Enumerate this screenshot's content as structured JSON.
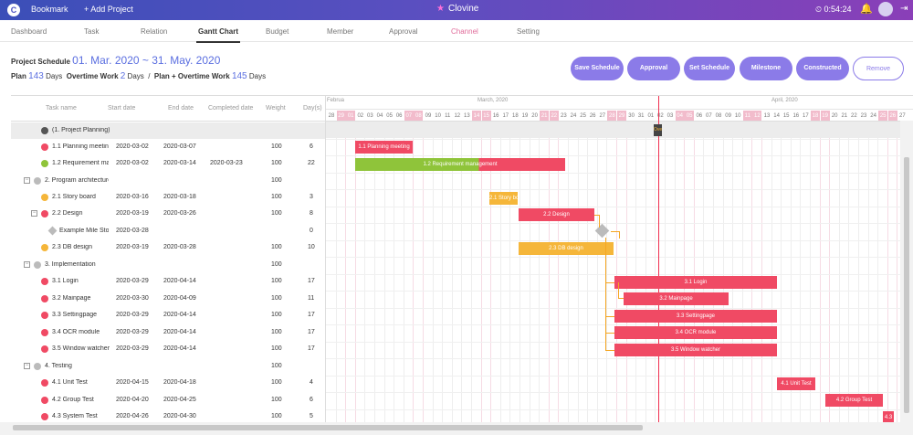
{
  "topbar": {
    "logo": "C",
    "bookmark": "Bookmark",
    "add_project": "+ Add Project",
    "brand": "Clovine",
    "clock": "⏲ 0:54:24",
    "bell_icon": "bell-icon",
    "logout_icon": "logout-icon"
  },
  "tabs": [
    "Dashboard",
    "Task",
    "Relation",
    "Gantt Chart",
    "Budget",
    "Member",
    "Approval",
    "Channel",
    "Setting"
  ],
  "active_tab": "Gantt Chart",
  "schedule": {
    "label": "Project Schedule",
    "range": "01. Mar. 2020 ~ 31. May. 2020",
    "plan_label": "Plan",
    "plan_days": "143",
    "days_unit": "Days",
    "overtime_label": "Overtime Work",
    "overtime_days": "2",
    "sep": "/",
    "total_label": "Plan + Overtime Work",
    "total_days": "145"
  },
  "buttons": {
    "save": "Save Schedule",
    "approval": "Approval",
    "set": "Set Schedule",
    "milestone": "Milestone",
    "constructed": "Constructed",
    "remove": "Remove"
  },
  "table_headers": [
    "Task name",
    "Start date",
    "End date",
    "Completed date",
    "Weight",
    "Day(s)"
  ],
  "rows": [
    {
      "name": "(1. Project Planning)",
      "start": "",
      "end": "",
      "completed": "",
      "weight": "",
      "days": ""
    },
    {
      "name": "1.1 Planning meeting",
      "start": "2020-03-02",
      "end": "2020-03-07",
      "completed": "",
      "weight": "100",
      "days": "6"
    },
    {
      "name": "1.2 Requirement management",
      "start": "2020-03-02",
      "end": "2020-03-14",
      "completed": "2020-03-23",
      "weight": "100",
      "days": "22"
    },
    {
      "name": "2. Program architecture",
      "start": "",
      "end": "",
      "completed": "",
      "weight": "100",
      "days": ""
    },
    {
      "name": "2.1 Story board",
      "start": "2020-03-16",
      "end": "2020-03-18",
      "completed": "",
      "weight": "100",
      "days": "3"
    },
    {
      "name": "2.2 Design",
      "start": "2020-03-19",
      "end": "2020-03-26",
      "completed": "",
      "weight": "100",
      "days": "8"
    },
    {
      "name": "Example Mile Stone",
      "start": "2020-03-28",
      "end": "",
      "completed": "",
      "weight": "",
      "days": "0"
    },
    {
      "name": "2.3 DB design",
      "start": "2020-03-19",
      "end": "2020-03-28",
      "completed": "",
      "weight": "100",
      "days": "10"
    },
    {
      "name": "3. Implementation",
      "start": "",
      "end": "",
      "completed": "",
      "weight": "100",
      "days": ""
    },
    {
      "name": "3.1 Login",
      "start": "2020-03-29",
      "end": "2020-04-14",
      "completed": "",
      "weight": "100",
      "days": "17"
    },
    {
      "name": "3.2 Mainpage",
      "start": "2020-03-30",
      "end": "2020-04-09",
      "completed": "",
      "weight": "100",
      "days": "11"
    },
    {
      "name": "3.3 Settingpage",
      "start": "2020-03-29",
      "end": "2020-04-14",
      "completed": "",
      "weight": "100",
      "days": "17"
    },
    {
      "name": "3.4 OCR module",
      "start": "2020-03-29",
      "end": "2020-04-14",
      "completed": "",
      "weight": "100",
      "days": "17"
    },
    {
      "name": "3.5 Window watcher",
      "start": "2020-03-29",
      "end": "2020-04-14",
      "completed": "",
      "weight": "100",
      "days": "17"
    },
    {
      "name": "4. Testing",
      "start": "",
      "end": "",
      "completed": "",
      "weight": "100",
      "days": ""
    },
    {
      "name": "4.1 Unit Test",
      "start": "2020-04-15",
      "end": "2020-04-18",
      "completed": "",
      "weight": "100",
      "days": "4"
    },
    {
      "name": "4.2 Group Test",
      "start": "2020-04-20",
      "end": "2020-04-25",
      "completed": "",
      "weight": "100",
      "days": "6"
    },
    {
      "name": "4.3 System Test",
      "start": "2020-04-26",
      "end": "2020-04-30",
      "completed": "",
      "weight": "100",
      "days": "5"
    }
  ],
  "timeline": {
    "months": [
      "Februa",
      "March, 2020",
      "April, 2020"
    ],
    "feb_days": [
      "28",
      "29"
    ],
    "mar_days": [
      "01",
      "02",
      "03",
      "04",
      "05",
      "06",
      "07",
      "08",
      "09",
      "10",
      "11",
      "12",
      "13",
      "14",
      "15",
      "16",
      "17",
      "18",
      "19",
      "20",
      "21",
      "22",
      "23",
      "24",
      "25",
      "26",
      "27",
      "28",
      "29",
      "30",
      "31"
    ],
    "apr_days": [
      "01",
      "02",
      "03",
      "04",
      "05",
      "06",
      "07",
      "08",
      "09",
      "10",
      "11",
      "12",
      "13",
      "14",
      "15",
      "16",
      "17",
      "18",
      "19",
      "20",
      "21",
      "22",
      "23",
      "24",
      "25",
      "26",
      "27"
    ],
    "today_marker": "Ove"
  },
  "bars": {
    "b1": "1.1 Planning meeting",
    "b2": "1.2 Requirement management",
    "b3": "2.1 Story board",
    "b4": "2.2 Design",
    "b5": "2.3 DB design",
    "b6": "3.1 Login",
    "b7": "3.2 Mainpage",
    "b8": "3.3 Settingpage",
    "b9": "3.4 OCR module",
    "b10": "3.5 Window watcher",
    "b11": "4.1 Unit Test",
    "b12": "4.2 Group Test",
    "b13": "4.3"
  },
  "colors": {
    "accent": "#8b7be8",
    "red": "#f04a64",
    "green": "#8fc43a",
    "orange": "#f5b63a"
  }
}
